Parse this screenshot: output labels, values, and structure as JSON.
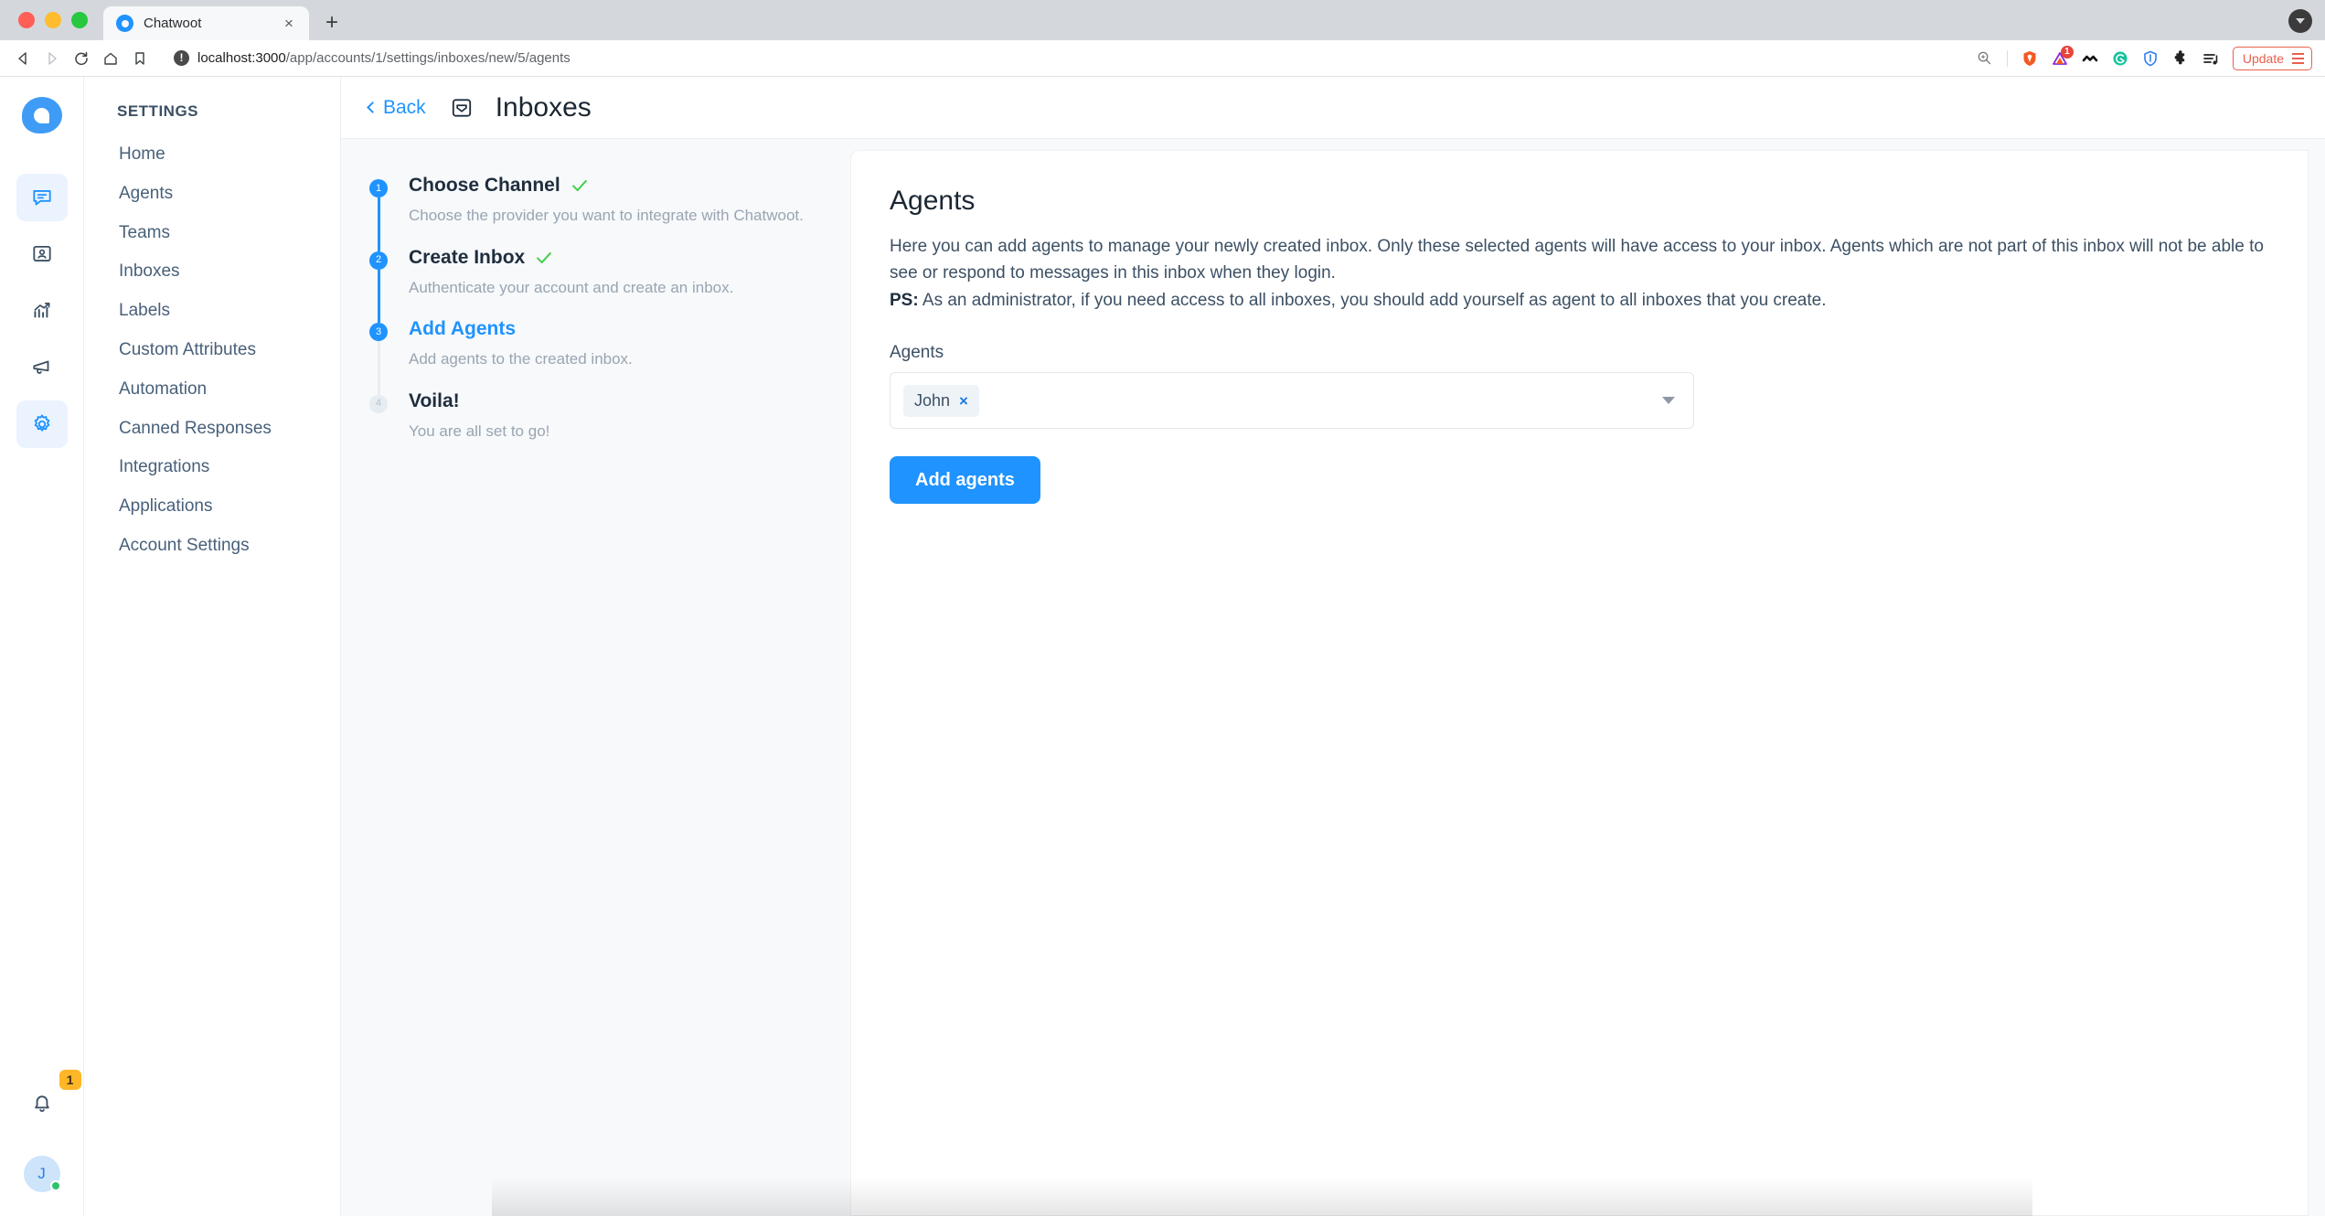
{
  "browser": {
    "tab": {
      "title": "Chatwoot",
      "favicon": "chatwoot-logo-icon",
      "close_label": "×"
    },
    "new_tab_label": "+",
    "url": {
      "host": "localhost:3000",
      "path": "/app/accounts/1/settings/inboxes/new/5/agents",
      "security_icon": "not-secure-info-icon"
    },
    "toolbar_icons": [
      {
        "name": "zoom-icon",
        "glyph": "⌕"
      },
      {
        "name": "brave-shield-icon",
        "glyph": "◉"
      },
      {
        "name": "brave-rewards-icon",
        "glyph": "△",
        "badge": "1"
      },
      {
        "name": "tampermonkey-icon",
        "glyph": "◠"
      },
      {
        "name": "grammarly-icon",
        "glyph": "G"
      },
      {
        "name": "vpn-shield-icon",
        "glyph": "▽"
      },
      {
        "name": "extensions-puzzle-icon",
        "glyph": "✦"
      },
      {
        "name": "playlist-icon",
        "glyph": "♫"
      }
    ],
    "update_button": "Update",
    "nav": {
      "back": "back-arrow-icon",
      "forward": "forward-arrow-icon",
      "reload": "reload-icon",
      "home": "home-icon",
      "bookmark": "bookmark-icon"
    }
  },
  "rail": {
    "logo": "chatwoot-logo",
    "items": [
      {
        "name": "conversations",
        "icon": "chat-bubble-icon",
        "active": true
      },
      {
        "name": "contacts",
        "icon": "contacts-book-icon",
        "active": false
      },
      {
        "name": "reports",
        "icon": "chart-trend-icon",
        "active": false
      },
      {
        "name": "campaigns",
        "icon": "megaphone-icon",
        "active": false
      },
      {
        "name": "settings",
        "icon": "gear-icon",
        "active": true
      }
    ],
    "notifications_badge": "1",
    "avatar_initial": "J"
  },
  "sidebar": {
    "title": "SETTINGS",
    "items": [
      {
        "label": "Home"
      },
      {
        "label": "Agents"
      },
      {
        "label": "Teams"
      },
      {
        "label": "Inboxes"
      },
      {
        "label": "Labels"
      },
      {
        "label": "Custom Attributes"
      },
      {
        "label": "Automation"
      },
      {
        "label": "Canned Responses"
      },
      {
        "label": "Integrations"
      },
      {
        "label": "Applications"
      },
      {
        "label": "Account Settings"
      }
    ]
  },
  "header": {
    "back_label": "Back",
    "title": "Inboxes",
    "icon": "inbox-tray-icon"
  },
  "wizard": {
    "steps": [
      {
        "number": "1",
        "name": "Choose Channel",
        "description": "Choose the provider you want to integrate with Chatwoot.",
        "state": "completed"
      },
      {
        "number": "2",
        "name": "Create Inbox",
        "description": "Authenticate your account and create an inbox.",
        "state": "completed"
      },
      {
        "number": "3",
        "name": "Add Agents",
        "description": "Add agents to the created inbox.",
        "state": "current"
      },
      {
        "number": "4",
        "name": "Voila!",
        "description": "You are all set to go!",
        "state": "upcoming"
      }
    ]
  },
  "main": {
    "title": "Agents",
    "description_line1": "Here you can add agents to manage your newly created inbox. Only these selected agents will have access to your inbox. Agents which are not part of this inbox will not be able to see or respond to messages in this inbox when they login.",
    "ps_label": "PS:",
    "ps_text": " As an administrator, if you need access to all inboxes, you should add yourself as agent to all inboxes that you create.",
    "field_label": "Agents",
    "selected_agents": [
      {
        "name": "John",
        "remove_label": "×"
      }
    ],
    "submit_label": "Add agents"
  },
  "colors": {
    "accent": "#1f93ff",
    "success": "#44ce4b",
    "text_dark": "#1f2d3d",
    "text_muted": "#9aa5b1",
    "badge_orange": "#ffb627",
    "page_bg": "#f7f9fb"
  }
}
